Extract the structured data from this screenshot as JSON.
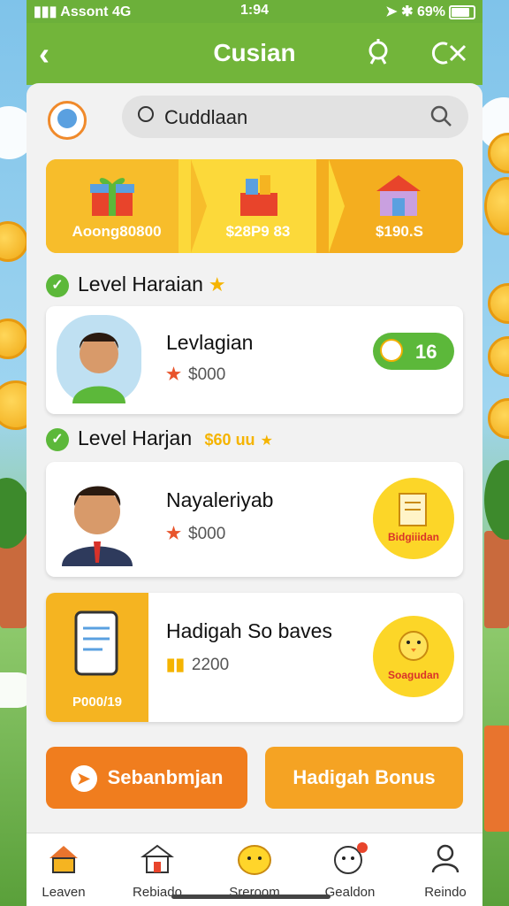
{
  "status": {
    "left": "Assont 4G",
    "time": "1:94",
    "battery": "69%"
  },
  "appbar": {
    "title": "Cusian"
  },
  "search": {
    "value": "Cuddlaan"
  },
  "banner": [
    {
      "label": "Aoong80800"
    },
    {
      "label": "$28P9 83"
    },
    {
      "label": "$190.S"
    }
  ],
  "sections": [
    {
      "title": "Level Haraian"
    },
    {
      "title": "Level Harjan",
      "suffix": "$60 uu"
    }
  ],
  "cards": [
    {
      "name": "Levlagian",
      "amount": "$000",
      "pill": "16"
    },
    {
      "name": "Nayaleriyab",
      "amount": "$000",
      "badge": "Bidgiiidan"
    },
    {
      "name": "Hadigah So baves",
      "amount": "2200",
      "badge": "Soagudan",
      "tile_label": "P000/19"
    }
  ],
  "buttons": {
    "primary": "Sebanbmjan",
    "secondary": "Hadigah Bonus"
  },
  "tabs": [
    {
      "label": "Leaven",
      "icon": "home-icon"
    },
    {
      "label": "Rebiado",
      "icon": "house-icon"
    },
    {
      "label": "Sreroom",
      "icon": "emoji-icon"
    },
    {
      "label": "Gealdon",
      "icon": "chat-icon"
    },
    {
      "label": "Reindo",
      "icon": "user-icon"
    }
  ],
  "colors": {
    "header": "#72b53a",
    "accent": "#f5b421",
    "green": "#5cb83a",
    "orange": "#f07d1e"
  }
}
